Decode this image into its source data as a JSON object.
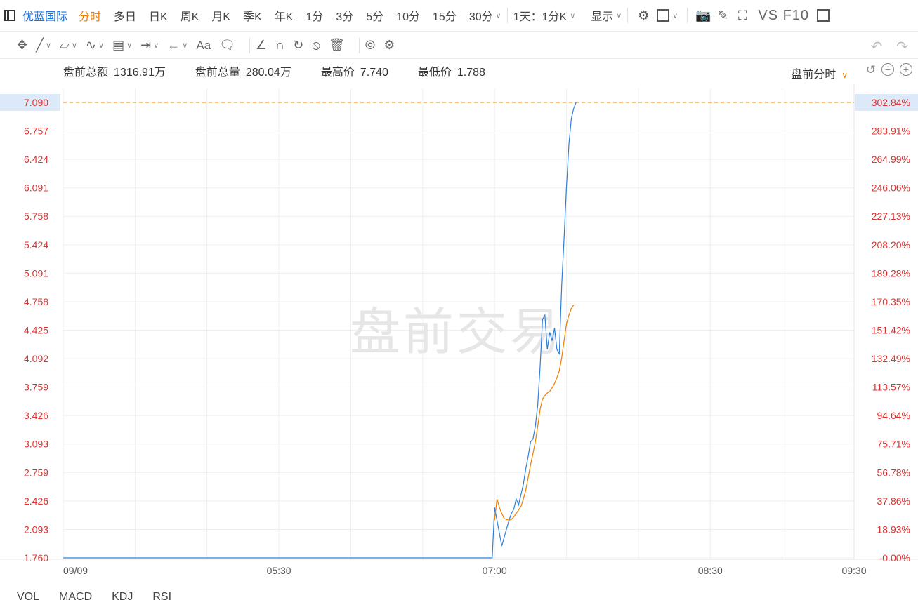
{
  "topbar": {
    "stock_name": "优蓝国际",
    "periods": [
      "分时",
      "多日",
      "日K",
      "周K",
      "月K",
      "季K",
      "年K",
      "1分",
      "3分",
      "5分",
      "10分",
      "15分"
    ],
    "active_period": "分时",
    "interval_select": "30分",
    "range_select": "1天：1分K",
    "display_select": "显示",
    "vs_f10": "VS F10"
  },
  "drawbar": {
    "text_tool": "Aa"
  },
  "stats": {
    "amount_label": "盘前总额",
    "amount_value": "1316.91万",
    "volume_label": "盘前总量",
    "volume_value": "280.04万",
    "high_label": "最高价",
    "high_value": "7.740",
    "low_label": "最低价",
    "low_value": "1.788",
    "session_select": "盘前分时"
  },
  "watermark": "盘前交易",
  "colors": {
    "price_line": "#2f7fd8",
    "avg_line": "#f07c00",
    "axis_label": "#e03030",
    "current_price_bg": "#dbe9f8"
  },
  "chart_data": {
    "type": "line",
    "title": "",
    "xlabel": "",
    "ylabel": "",
    "y_ticks": [
      "7.090",
      "6.757",
      "6.424",
      "6.091",
      "5.758",
      "5.424",
      "5.091",
      "4.758",
      "4.425",
      "4.092",
      "3.759",
      "3.426",
      "3.093",
      "2.759",
      "2.426",
      "2.093",
      "1.760"
    ],
    "y_pct_ticks": [
      "302.84%",
      "283.91%",
      "264.99%",
      "246.06%",
      "227.13%",
      "208.20%",
      "189.28%",
      "170.35%",
      "151.42%",
      "132.49%",
      "113.57%",
      "94.64%",
      "75.71%",
      "56.78%",
      "37.86%",
      "18.93%",
      "-0.00%"
    ],
    "ylim": [
      1.76,
      7.09
    ],
    "x_tick_labels": [
      "09/09",
      "05:30",
      "07:00",
      "08:30",
      "09:30"
    ],
    "x_minutes_range": [
      240,
      570
    ],
    "x_tick_minutes": [
      240,
      330,
      420,
      510,
      570
    ],
    "current_price": "7.090",
    "current_pct": "302.84%",
    "series": [
      {
        "role": "price",
        "points": [
          [
            240,
            1.76
          ],
          [
            419,
            1.76
          ],
          [
            420,
            2.35
          ],
          [
            421,
            2.2
          ],
          [
            422,
            2.05
          ],
          [
            423,
            1.9
          ],
          [
            424,
            2.0
          ],
          [
            425,
            2.1
          ],
          [
            426,
            2.2
          ],
          [
            427,
            2.28
          ],
          [
            428,
            2.33
          ],
          [
            429,
            2.45
          ],
          [
            430,
            2.38
          ],
          [
            431,
            2.5
          ],
          [
            432,
            2.62
          ],
          [
            433,
            2.8
          ],
          [
            434,
            2.95
          ],
          [
            435,
            3.12
          ],
          [
            436,
            3.15
          ],
          [
            437,
            3.3
          ],
          [
            438,
            3.55
          ],
          [
            439,
            4.0
          ],
          [
            440,
            4.55
          ],
          [
            441,
            4.6
          ],
          [
            442,
            4.2
          ],
          [
            443,
            4.4
          ],
          [
            444,
            4.3
          ],
          [
            445,
            4.45
          ],
          [
            446,
            4.2
          ],
          [
            447,
            4.15
          ],
          [
            448,
            4.95
          ],
          [
            449,
            5.5
          ],
          [
            450,
            6.1
          ],
          [
            451,
            6.6
          ],
          [
            452,
            6.9
          ],
          [
            453,
            7.02
          ],
          [
            454,
            7.09
          ]
        ]
      },
      {
        "role": "average",
        "points": [
          [
            420,
            2.2
          ],
          [
            421,
            2.45
          ],
          [
            422,
            2.35
          ],
          [
            423,
            2.28
          ],
          [
            424,
            2.22
          ],
          [
            425,
            2.21
          ],
          [
            426,
            2.2
          ],
          [
            427,
            2.21
          ],
          [
            428,
            2.24
          ],
          [
            429,
            2.28
          ],
          [
            430,
            2.32
          ],
          [
            431,
            2.36
          ],
          [
            432,
            2.45
          ],
          [
            433,
            2.55
          ],
          [
            434,
            2.7
          ],
          [
            435,
            2.85
          ],
          [
            436,
            2.98
          ],
          [
            437,
            3.12
          ],
          [
            438,
            3.3
          ],
          [
            439,
            3.5
          ],
          [
            440,
            3.62
          ],
          [
            441,
            3.66
          ],
          [
            442,
            3.69
          ],
          [
            443,
            3.71
          ],
          [
            444,
            3.75
          ],
          [
            445,
            3.8
          ],
          [
            446,
            3.87
          ],
          [
            447,
            3.95
          ],
          [
            448,
            4.1
          ],
          [
            449,
            4.3
          ],
          [
            450,
            4.5
          ],
          [
            451,
            4.6
          ],
          [
            452,
            4.68
          ],
          [
            453,
            4.72
          ]
        ]
      }
    ]
  },
  "indicators": [
    "VOL",
    "MACD",
    "KDJ",
    "RSI"
  ]
}
